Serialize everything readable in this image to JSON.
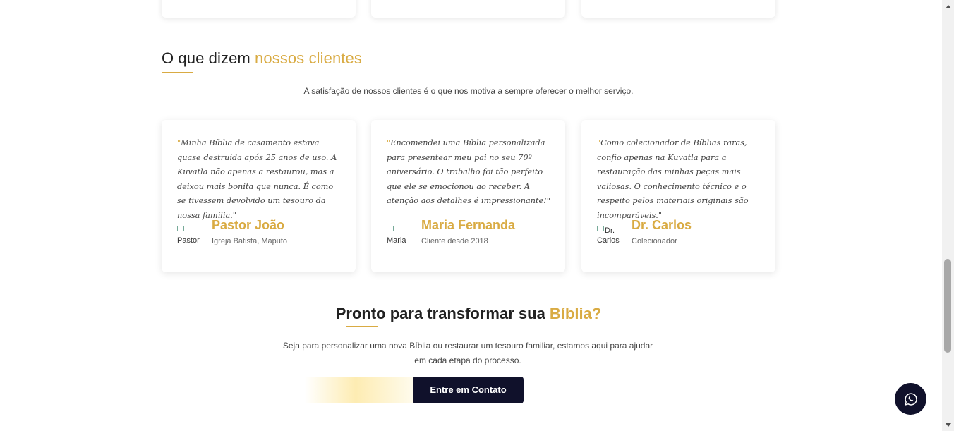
{
  "testimonials": {
    "title_main": "O que dizem ",
    "title_accent": "nossos clientes",
    "subtitle": "A satisfação de nossos clientes é o que nos motiva a sempre oferecer o melhor serviço.",
    "items": [
      {
        "quote": "Minha Bíblia de casamento estava quase destruída após 25 anos de uso. A Kuvatla não apenas a restaurou, mas a deixou mais bonita que nunca. É como se tivessem devolvido um tesouro da nossa família.",
        "avatar_alt": "Pastor",
        "name": "Pastor João",
        "role": "Igreja Batista, Maputo"
      },
      {
        "quote": "Encomendei uma Bíblia personalizada para presentear meu pai no seu 70º aniversário. O trabalho foi tão perfeito que ele se emocionou ao receber. A atenção aos detalhes é impressionante!",
        "avatar_alt": "Maria",
        "name": "Maria Fernanda",
        "role": "Cliente desde 2018"
      },
      {
        "quote": "Como colecionador de Bíblias raras, confio apenas na Kuvatla para a restauração das minhas peças mais valiosas. O conhecimento técnico e o respeito pelos materiais originais são incomparáveis.",
        "avatar_alt": "Dr. Carlos",
        "name": "Dr. Carlos",
        "role": "Colecionador"
      }
    ]
  },
  "cta": {
    "title_main": "Pronto para transformar sua ",
    "title_accent": "Bíblia?",
    "text": "Seja para personalizar uma nova Bíblia ou restaurar um tesouro familiar, estamos aqui para ajudar em cada etapa do processo.",
    "button_label": "Entre em Contato"
  },
  "floating": {
    "icon": "whatsapp-icon"
  },
  "colors": {
    "accent": "#d9ab43",
    "dark": "#10112b"
  }
}
